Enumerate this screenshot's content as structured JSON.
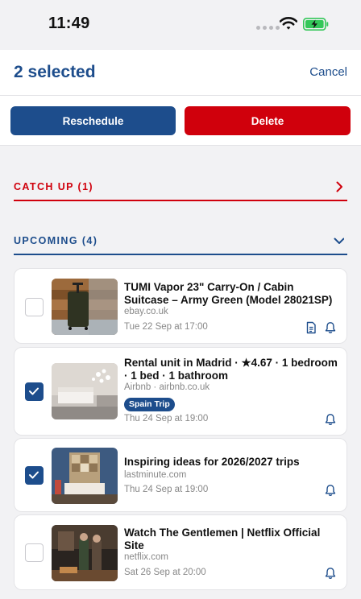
{
  "status_bar": {
    "time": "11:49"
  },
  "header": {
    "title": "2 selected",
    "cancel_label": "Cancel"
  },
  "actions": {
    "reschedule_label": "Reschedule",
    "delete_label": "Delete"
  },
  "sections": {
    "catch_up": {
      "label": "CATCH UP (1)"
    },
    "upcoming": {
      "label": "UPCOMING (4)"
    }
  },
  "items": [
    {
      "title": "TUMI Vapor 23\" Carry-On / Cabin Suitcase – Army Green (Model 28021SP)",
      "source": "ebay.co.uk",
      "date": "Tue 22 Sep at 17:00",
      "checked": false,
      "icons": [
        "document-icon",
        "bell-icon"
      ]
    },
    {
      "title": "Rental unit in Madrid · ★4.67 · 1 bedroom · 1 bed · 1 bathroom",
      "source": "Airbnb · airbnb.co.uk",
      "tag": "Spain Trip",
      "date": "Thu 24 Sep at 19:00",
      "checked": true,
      "icons": [
        "bell-icon"
      ]
    },
    {
      "title": "Inspiring ideas for 2026/2027 trips",
      "source": "lastminute.com",
      "date": "Thu 24 Sep at 19:00",
      "checked": true,
      "icons": [
        "bell-icon"
      ]
    },
    {
      "title": "Watch The Gentlemen | Netflix Official Site",
      "source": "netflix.com",
      "date": "Sat 26 Sep at 20:00",
      "checked": false,
      "icons": [
        "bell-icon"
      ]
    }
  ],
  "colors": {
    "brand_blue": "#1d4d8c",
    "danger_red": "#d0000c",
    "battery_green": "#34c759"
  }
}
